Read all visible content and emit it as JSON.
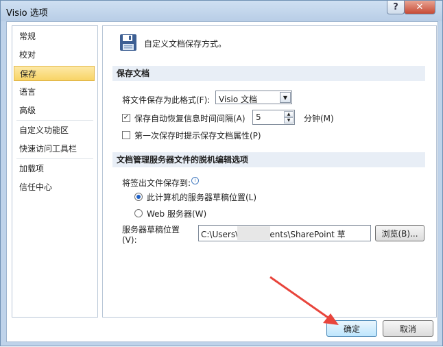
{
  "window": {
    "title": "Visio 选项",
    "help": "?",
    "close": "✕"
  },
  "sidebar": {
    "items": [
      {
        "label": "常规"
      },
      {
        "label": "校对"
      },
      {
        "label": "保存"
      },
      {
        "label": "语言"
      },
      {
        "label": "高级"
      },
      {
        "label": "自定义功能区"
      },
      {
        "label": "快速访问工具栏"
      },
      {
        "label": "加载项"
      },
      {
        "label": "信任中心"
      }
    ],
    "selected": "保存"
  },
  "main": {
    "header": {
      "icon": "floppy-disk-icon",
      "text": "自定义文档保存方式。"
    },
    "section1": {
      "title": "保存文档",
      "format_label": "将文件保存为此格式(F):",
      "format_value": "Visio 文档",
      "autorecover_label": "保存自动恢复信息时间间隔(A)",
      "autorecover_checked": true,
      "autorecover_value": "5",
      "autorecover_unit": "分钟(M)",
      "prompt_label": "第一次保存时提示保存文档属性(P)",
      "prompt_checked": false
    },
    "section2": {
      "title": "文档管理服务器文件的脱机编辑选项",
      "checkout_label": "将签出文件保存到:",
      "radio_local": "此计算机的服务器草稿位置(L)",
      "radio_web": "Web 服务器(W)",
      "drafts_label_1": "服务器草稿位置",
      "drafts_label_2": "(V):",
      "drafts_path": "C:\\Users\\         Documents\\SharePoint 草",
      "browse": "浏览(B)..."
    }
  },
  "footer": {
    "ok": "确定",
    "cancel": "取消"
  },
  "colors": {
    "selected_nav": "#f8d466",
    "arrow": "#e8453c",
    "section_bg": "#e8eef6"
  }
}
